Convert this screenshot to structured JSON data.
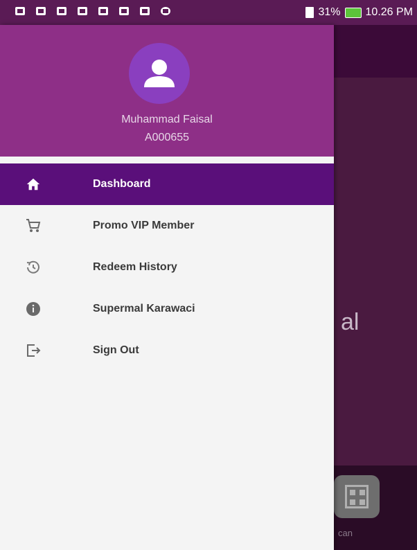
{
  "status_bar": {
    "battery_percent": "31%",
    "time": "10.26 PM",
    "notification_icons": [
      "tv-icon",
      "tv-icon",
      "tv-icon",
      "tv-icon",
      "tv-icon",
      "tv-icon",
      "gmail-icon",
      "android-icon"
    ]
  },
  "drawer": {
    "user": {
      "name": "Muhammad Faisal",
      "id": "A000655"
    },
    "items": [
      {
        "label": "Dashboard",
        "icon": "home-icon",
        "active": true
      },
      {
        "label": "Promo VIP Member",
        "icon": "cart-icon",
        "active": false
      },
      {
        "label": "Redeem History",
        "icon": "history-icon",
        "active": false
      },
      {
        "label": "Supermal Karawaci",
        "icon": "info-icon",
        "active": false
      },
      {
        "label": "Sign Out",
        "icon": "sign-out-icon",
        "active": false
      }
    ]
  },
  "background": {
    "partial_text": "al",
    "scan_label": "can"
  },
  "colors": {
    "header": "#8e2f87",
    "active_item": "#5a0f7a",
    "avatar": "#8a3fbf"
  }
}
